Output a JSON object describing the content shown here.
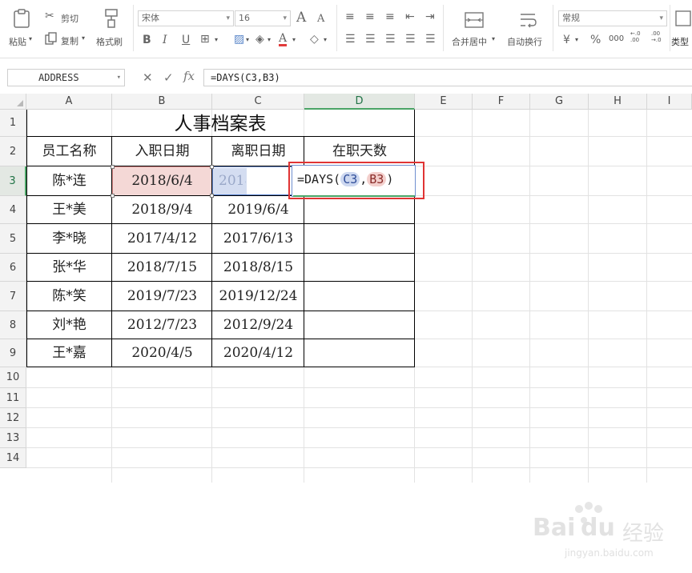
{
  "ribbon": {
    "paste": "粘贴",
    "cut": "剪切",
    "copy": "复制",
    "format_painter": "格式刷",
    "font_name": "宋体",
    "font_size": "16",
    "bold": "B",
    "italic": "I",
    "underline": "U",
    "font_grow": "A",
    "font_shrink": "A",
    "merge_center": "合并居中",
    "wrap_text": "自动换行",
    "number_format": "常规",
    "currency_symbol": "¥",
    "percent_symbol": "%",
    "thousands": "000",
    "dec_increase": "←.0 .00",
    "dec_decrease": ".00 →.0",
    "type_convert": "类型"
  },
  "formula_bar": {
    "name_box": "ADDRESS",
    "cancel": "✕",
    "confirm": "✓",
    "fx": "fx",
    "formula": "=DAYS(C3,B3)"
  },
  "columns": [
    "A",
    "B",
    "C",
    "D",
    "E",
    "F",
    "G",
    "H",
    "I"
  ],
  "rows": [
    "1",
    "2",
    "3",
    "4",
    "5",
    "6",
    "7",
    "8",
    "9",
    "10",
    "11",
    "12",
    "13",
    "14"
  ],
  "table": {
    "title": "人事档案表",
    "headers": [
      "员工名称",
      "入职日期",
      "离职日期",
      "在职天数"
    ],
    "rows": [
      [
        "陈*连",
        "2018/6/4",
        "2018",
        ""
      ],
      [
        "王*美",
        "2018/9/4",
        "2019/6/4",
        ""
      ],
      [
        "李*晓",
        "2017/4/12",
        "2017/6/13",
        ""
      ],
      [
        "张*华",
        "2018/7/15",
        "2018/8/15",
        ""
      ],
      [
        "陈*笑",
        "2019/7/23",
        "2019/12/24",
        ""
      ],
      [
        "刘*艳",
        "2012/7/23",
        "2012/9/24",
        ""
      ],
      [
        "王*嘉",
        "2020/4/5",
        "2020/4/12",
        ""
      ]
    ]
  },
  "edit_cell": {
    "prefix": "=DAYS(",
    "ref1": "C3",
    "sep": ",",
    "ref2": "B3",
    "suffix": ")"
  },
  "watermark": {
    "brand": "Bai",
    "brand2": "du",
    "cn": "经验",
    "url": "jingyan.baidu.com"
  },
  "colors": {
    "accent_green": "#4aa466",
    "ref_blue": "#6f8fcf",
    "ref_red": "#d98a88",
    "highlight_box": "#e03434"
  }
}
